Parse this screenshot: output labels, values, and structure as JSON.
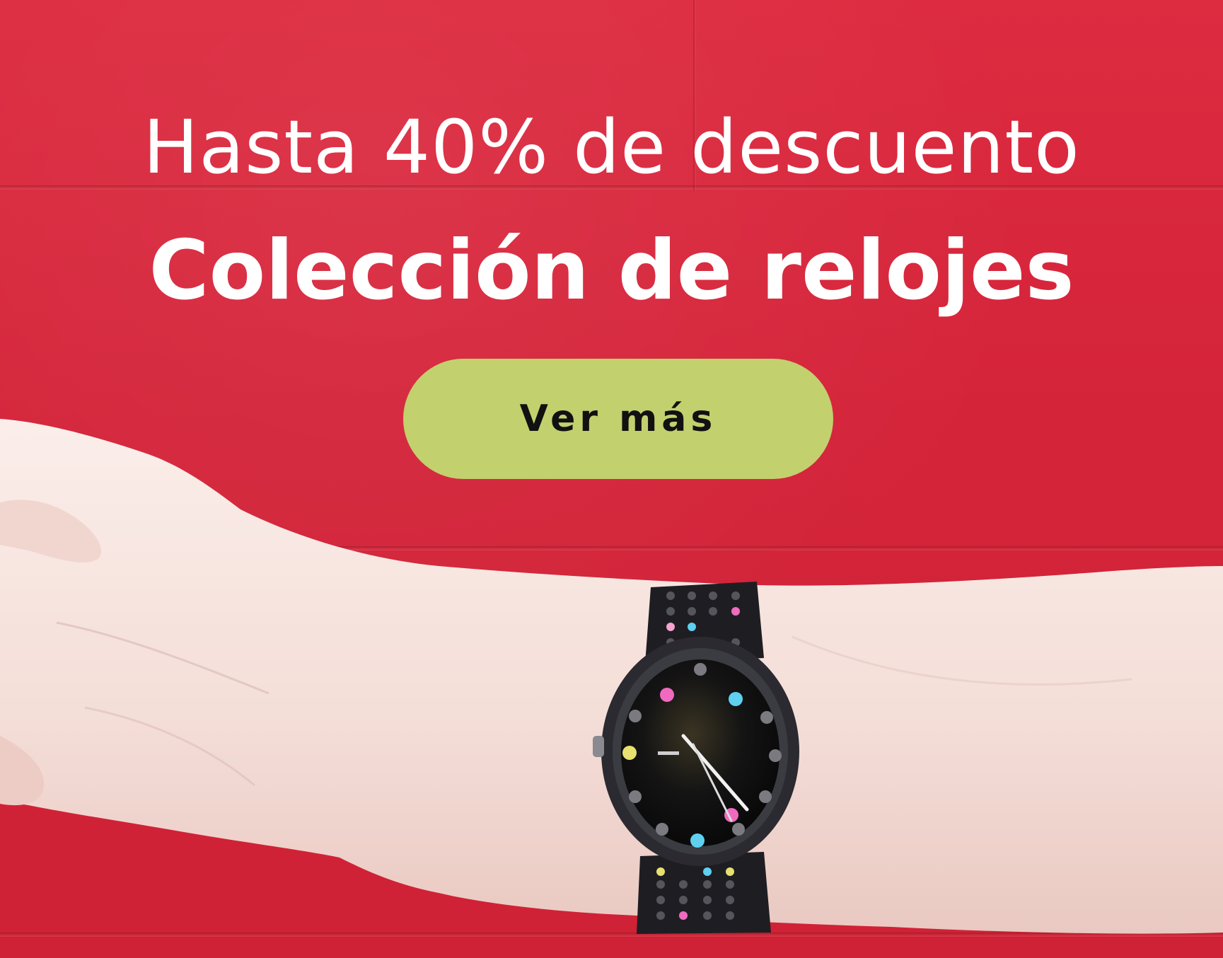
{
  "banner": {
    "headline": "Hasta 40% de descuento",
    "title": "Colección de relojes",
    "cta_label": "Ver más"
  },
  "colors": {
    "background_red": "#d8253a",
    "cta_green": "#c2d06e",
    "text_white": "#ffffff",
    "cta_text": "#111111"
  },
  "photo": {
    "subject": "wrist-with-wristwatch-icon"
  }
}
